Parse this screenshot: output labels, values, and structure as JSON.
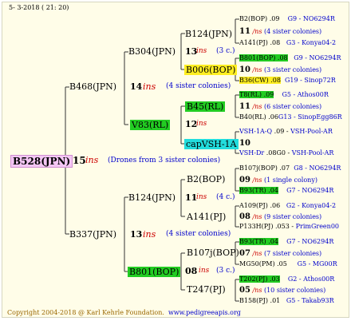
{
  "header": {
    "date": "5- 3-2018 ( 21: 20)"
  },
  "footer": {
    "copyright": "Copyright 2004-2018 @ Karl Kehrle Foundation.",
    "url": "www.pedigreeapis.org"
  },
  "root": {
    "id": "B528(JPN)",
    "ins": "15",
    "ins_label": "ins",
    "note": "(Drones from 3 sister colonies)"
  },
  "father_top": {
    "id": "B468(JPN)",
    "ins": "14",
    "ins_label": "ins",
    "note": "(4 sister colonies)"
  },
  "father_bottom": {
    "id": "B337(JPN)",
    "ins": "13",
    "ins_label": "ins",
    "note": "(4 sister colonies)"
  },
  "gp": {
    "b304": {
      "id": "B304(JPN)",
      "ins": "13",
      "ins_label": "ins",
      "note": "(3 c.)"
    },
    "v83": {
      "id": "V83(RL)",
      "ins": "12",
      "ins_label": "ins"
    },
    "b124": {
      "id": "B124(JPN)",
      "ins": "11",
      "ins_label": "ins",
      "note": "(4 c.)"
    },
    "b801": {
      "id": "B801(BOP)",
      "ins": "08",
      "ins_label": "ins",
      "note": "(3 c.)"
    }
  },
  "ggp": {
    "b124top": {
      "id": "B124(JPN)",
      "ins": "11",
      "ins_label": "/ns",
      "note": "(4 sister colonies)"
    },
    "b006": {
      "id": "B006(BOP)",
      "ins": "10",
      "ins_label": "/ns",
      "note": "(3 sister colonies)"
    },
    "b45": {
      "id": "B45(RL)",
      "ins": "11",
      "ins_label": "/ns",
      "note": "(6 sister colonies)"
    },
    "capvsh": {
      "id": "capVSH-1A",
      "ins": "10",
      "ins_label": "",
      "note": ""
    },
    "b2": {
      "id": "B2(BOP)",
      "ins": "09",
      "ins_label": "/ns",
      "note": "(1 single colony)"
    },
    "a141": {
      "id": "A141(PJ)",
      "ins": "08",
      "ins_label": "/ns",
      "note": "(9 sister colonies)"
    },
    "b107": {
      "id": "B107j(BOP)",
      "ins": "07",
      "ins_label": "/ns",
      "note": "(7 sister colonies)"
    },
    "t247": {
      "id": "T247(PJ)",
      "ins": "05",
      "ins_label": "/ns",
      "note": "(10 sister colonies)"
    }
  },
  "leaves": [
    {
      "id": "B2(BOP)",
      "year": ".09",
      "code": "G9 - NO6294R"
    },
    {
      "id": "A141(PJ)",
      "year": ".08",
      "code": "G3 - Konya04-2"
    },
    {
      "id": "B801(BOP)",
      "year": ".08",
      "code": "G9 - NO6294R"
    },
    {
      "id": "B36(CW)",
      "year": ".08",
      "code": "G19 - Sinop72R"
    },
    {
      "id": "T8(RL)",
      "year": ".09",
      "code": "G5 - Athos00R"
    },
    {
      "id": "B40(RL)",
      "year": ".06",
      "code": "G13 - SinopEgg86R"
    },
    {
      "id": "VSH-1A-Q",
      "year": ".09",
      "code": "VSH-Pool-AR"
    },
    {
      "id": "VSH-Dr",
      "year": ".08G0",
      "code": "VSH-Pool-AR"
    },
    {
      "id": "B107j(BOP)",
      "year": ".07",
      "code": "G8 - NO6294R"
    },
    {
      "id": "B93(TR)",
      "year": ".04",
      "code": "G7 - NO6294R"
    },
    {
      "id": "A109(PJ)",
      "year": ".06",
      "code": "G2 - Konya04-2"
    },
    {
      "id": "P133H(PJ)",
      "year": ".053",
      "code": "PrimGreen00"
    },
    {
      "id": "B93(TR)",
      "year": ".04",
      "code": "G7 - NO6294R"
    },
    {
      "id": "MG50(PM)",
      "year": ".05",
      "code": "G5 - MG00R"
    },
    {
      "id": "T202(PJ)",
      "year": ".03",
      "code": "G2 - Athos00R"
    },
    {
      "id": "B158(PJ)",
      "year": ".01",
      "code": "G5 - Takab93R"
    }
  ]
}
